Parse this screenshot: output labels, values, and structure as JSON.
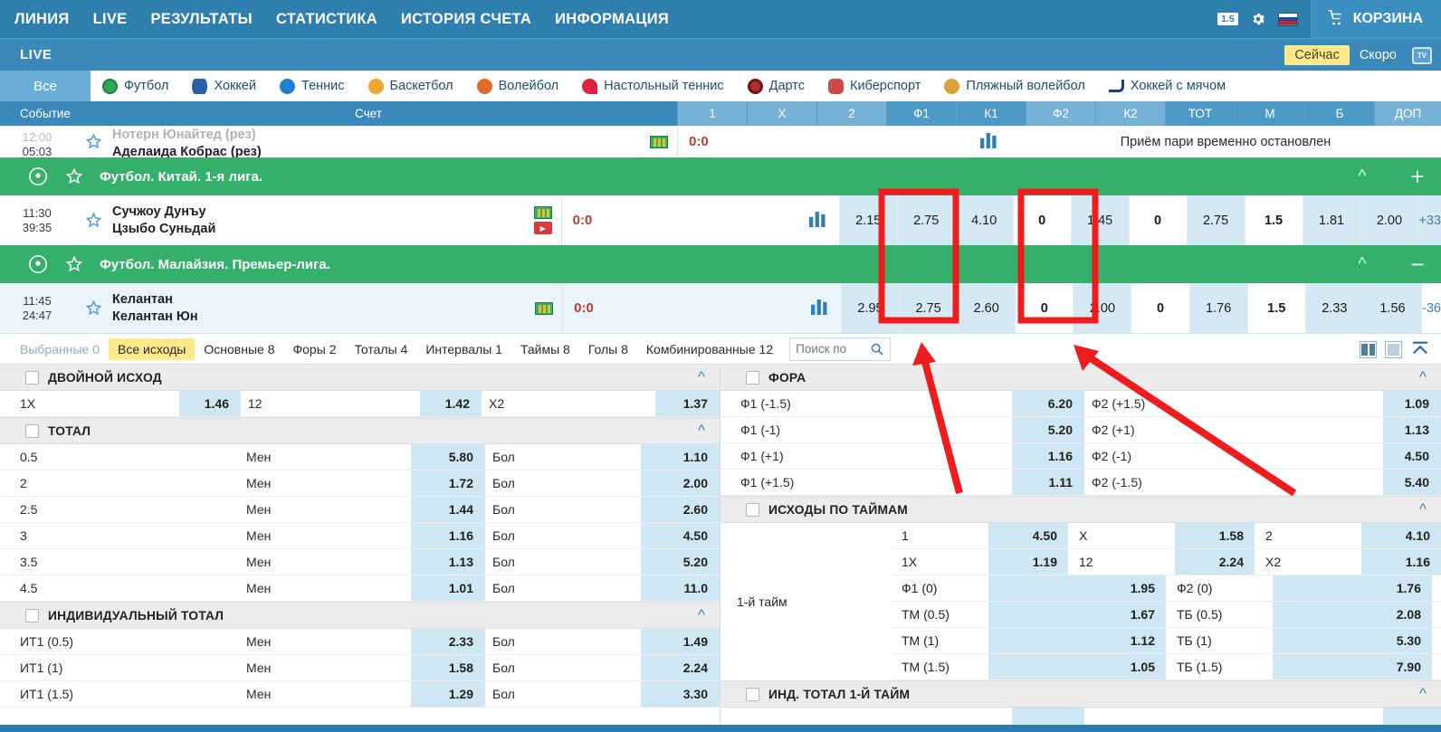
{
  "topnav": {
    "items": [
      "ЛИНИЯ",
      "LIVE",
      "РЕЗУЛЬТАТЫ",
      "СТАТИСТИКА",
      "ИСТОРИЯ СЧЕТА",
      "ИНФОРМАЦИЯ"
    ],
    "odds_format_badge": "1.5",
    "settings_icon": "gear-icon",
    "language_flag": "ru-flag-icon",
    "cart_label": "КОРЗИНА",
    "cart_icon": "cart-icon"
  },
  "livebar": {
    "title": "LIVE",
    "now_label": "Сейчас",
    "soon_label": "Скоро",
    "tv_label": "TV"
  },
  "sport_tabs": [
    {
      "label": "Все",
      "icon": "all-icon",
      "selected": true,
      "color": "#6aaed6"
    },
    {
      "label": "Футбол",
      "icon": "football-icon",
      "color": "#2eaa55"
    },
    {
      "label": "Хоккей",
      "icon": "hockey-icon",
      "color": "#2a5fa8"
    },
    {
      "label": "Теннис",
      "icon": "tennis-icon",
      "color": "#1f7fd0"
    },
    {
      "label": "Баскетбол",
      "icon": "basketball-icon",
      "color": "#f0a62a"
    },
    {
      "label": "Волейбол",
      "icon": "volleyball-icon",
      "color": "#e06a2a"
    },
    {
      "label": "Настольный теннис",
      "icon": "table-tennis-icon",
      "color": "#e0213c"
    },
    {
      "label": "Дартс",
      "icon": "darts-icon",
      "color": "#b02a2a"
    },
    {
      "label": "Киберспорт",
      "icon": "esports-icon",
      "color": "#d04a4a"
    },
    {
      "label": "Пляжный волейбол",
      "icon": "beach-volleyball-icon",
      "color": "#d9a23c"
    },
    {
      "label": "Хоккей с мячом",
      "icon": "bandy-icon",
      "color": "#1b3f86"
    }
  ],
  "columns": {
    "event": "Событие",
    "score": "Счет",
    "odds": [
      "1",
      "X",
      "2",
      "Ф1",
      "К1",
      "Ф2",
      "К2",
      "ТОТ",
      "М",
      "Б",
      "ДОП"
    ]
  },
  "matches": [
    {
      "time_top": "12:00",
      "time_bottom": "05:03",
      "team1": "Нотерн Юнайтед (рез)",
      "team2": "Аделаида Кобрас (рез)",
      "score": "0:0",
      "status_text": "Приём пари временно остановлен",
      "suspended": true,
      "odds": []
    },
    {
      "time_top": "11:30",
      "time_bottom": "39:35",
      "team1": "Сучжоу Дунъу",
      "team2": "Цзыбо Суньдай",
      "score": "0:0",
      "suspended": false,
      "odds": [
        "2.15",
        "2.75",
        "4.10",
        "0",
        "1.45",
        "0",
        "2.75",
        "1.5",
        "1.81",
        "2.00",
        "+33"
      ]
    },
    {
      "time_top": "11:45",
      "time_bottom": "24:47",
      "team1": "Келантан",
      "team2": "Келантан Юн",
      "score": "0:0",
      "suspended": false,
      "selected": true,
      "odds": [
        "2.95",
        "2.75",
        "2.60",
        "0",
        "2.00",
        "0",
        "1.76",
        "1.5",
        "2.33",
        "1.56",
        "-36"
      ]
    }
  ],
  "leagues": [
    {
      "name": "Футбол. Китай. 1-я лига.",
      "toggle": "+"
    },
    {
      "name": "Футбол. Малайзия. Премьер-лига.",
      "toggle": "−"
    }
  ],
  "market_tabs": [
    {
      "label": "Выбранные 0",
      "state": "dim"
    },
    {
      "label": "Все исходы",
      "state": "selected"
    },
    {
      "label": "Основные 8",
      "state": "normal"
    },
    {
      "label": "Форы 2",
      "state": "normal"
    },
    {
      "label": "Тоталы 4",
      "state": "normal"
    },
    {
      "label": "Интервалы 1",
      "state": "normal"
    },
    {
      "label": "Таймы 8",
      "state": "normal"
    },
    {
      "label": "Голы 8",
      "state": "normal"
    },
    {
      "label": "Комбинированные 12",
      "state": "normal"
    }
  ],
  "search": {
    "placeholder": "Поиск по",
    "value": "",
    "icon": "search-icon"
  },
  "view_buttons": [
    "two-column-view-icon",
    "one-column-view-icon",
    "collapse-all-icon"
  ],
  "left_markets": [
    {
      "title": "ДВОЙНОЙ ИСХОД",
      "layout": "triple",
      "rows": [
        {
          "cells": [
            {
              "label": "1X",
              "odd": "1.46",
              "trend": "down"
            },
            {
              "label": "12",
              "odd": "1.42",
              "trend": "up"
            },
            {
              "label": "X2",
              "odd": "1.37",
              "trend": "down"
            }
          ]
        }
      ]
    },
    {
      "title": "ТОТАЛ",
      "layout": "total",
      "rows": [
        {
          "line": "0.5",
          "under_label": "Мен",
          "under": "5.80",
          "under_trend": "down",
          "over_label": "Бол",
          "over": "1.10",
          "over_trend": "up"
        },
        {
          "line": "2",
          "under_label": "Мен",
          "under": "1.72",
          "under_trend": "down",
          "over_label": "Бол",
          "over": "2.00",
          "over_trend": "up"
        },
        {
          "line": "2.5",
          "under_label": "Мен",
          "under": "1.44",
          "under_trend": "none",
          "over_label": "Бол",
          "over": "2.60",
          "over_trend": "none"
        },
        {
          "line": "3",
          "under_label": "Мен",
          "under": "1.16",
          "under_trend": "down",
          "over_label": "Бол",
          "over": "4.50",
          "over_trend": "up"
        },
        {
          "line": "3.5",
          "under_label": "Мен",
          "under": "1.13",
          "under_trend": "down",
          "over_label": "Бол",
          "over": "5.20",
          "over_trend": "up"
        },
        {
          "line": "4.5",
          "under_label": "Мен",
          "under": "1.01",
          "under_trend": "down",
          "over_label": "Бол",
          "over": "11.0",
          "over_trend": "up"
        }
      ]
    },
    {
      "title": "ИНДИВИДУАЛЬНЫЙ ТОТАЛ",
      "layout": "total",
      "rows": [
        {
          "line": "ИТ1 (0.5)",
          "under_label": "Мен",
          "under": "2.33",
          "under_trend": "none",
          "over_label": "Бол",
          "over": "1.49",
          "over_trend": "up"
        },
        {
          "line": "ИТ1 (1)",
          "under_label": "Мен",
          "under": "1.58",
          "under_trend": "down",
          "over_label": "Бол",
          "over": "2.24",
          "over_trend": "up"
        },
        {
          "line": "ИТ1 (1.5)",
          "under_label": "Мен",
          "under": "1.29",
          "under_trend": "down",
          "over_label": "Бол",
          "over": "3.30",
          "over_trend": "up"
        }
      ]
    }
  ],
  "right_markets": [
    {
      "title": "ФОРА",
      "layout": "pair",
      "rows": [
        {
          "l_label": "Ф1 (-1.5)",
          "l_odd": "6.20",
          "l_trend": "up",
          "r_label": "Ф2 (+1.5)",
          "r_odd": "1.09",
          "r_trend": "none"
        },
        {
          "l_label": "Ф1 (-1)",
          "l_odd": "5.20",
          "l_trend": "up",
          "r_label": "Ф2 (+1)",
          "r_odd": "1.13",
          "r_trend": "none"
        },
        {
          "l_label": "Ф1 (+1)",
          "l_odd": "1.16",
          "l_trend": "none",
          "r_label": "Ф2 (-1)",
          "r_odd": "4.50",
          "r_trend": "none"
        },
        {
          "l_label": "Ф1 (+1.5)",
          "l_odd": "1.11",
          "l_trend": "down",
          "r_label": "Ф2 (-1.5)",
          "r_odd": "5.40",
          "r_trend": "up"
        }
      ]
    },
    {
      "title": "ИСХОДЫ ПО ТАЙМАМ",
      "layout": "halves",
      "group_label": "1-й тайм",
      "rows": [
        {
          "c1": "1",
          "v1": "4.50",
          "t1": "none",
          "c2": "X",
          "v2": "1.58",
          "t2": "down",
          "c3": "2",
          "v3": "4.10",
          "t3": "none"
        },
        {
          "c1": "1X",
          "v1": "1.19",
          "t1": "none",
          "c2": "12",
          "v2": "2.24",
          "t2": "up",
          "c3": "X2",
          "v3": "1.16",
          "t3": "none"
        },
        {
          "c1": "Ф1 (0)",
          "v1": "1.95",
          "t1": "none",
          "c2": "Ф2 (0)",
          "v2": "1.76",
          "t2": "none"
        },
        {
          "c1": "ТМ (0.5)",
          "v1": "1.67",
          "t1": "down",
          "c2": "ТБ (0.5)",
          "v2": "2.08",
          "t2": "up"
        },
        {
          "c1": "ТМ (1)",
          "v1": "1.12",
          "t1": "down",
          "c2": "ТБ (1)",
          "v2": "5.30",
          "t2": "up"
        },
        {
          "c1": "ТМ (1.5)",
          "v1": "1.05",
          "t1": "down",
          "c2": "ТБ (1.5)",
          "v2": "7.90",
          "t2": "up"
        }
      ]
    },
    {
      "title": "ИНД. ТОТАЛ 1-Й ТАЙМ",
      "layout": "pair",
      "rows": []
    }
  ],
  "annotations": {
    "highlight_color": "#ee1c1c",
    "boxes": [
      "odds-f1-column-highlight",
      "odds-f2-column-highlight"
    ],
    "arrows": [
      "arrow-to-f1-column",
      "arrow-to-f2-column"
    ]
  },
  "colors": {
    "header_blue": "#2e7fae",
    "bar_blue": "#3b89bb",
    "league_green": "#35b06a",
    "odd_bg": "#d4e9f3",
    "highlight_yellow": "#ffe98a",
    "score_red": "#c0392b"
  }
}
